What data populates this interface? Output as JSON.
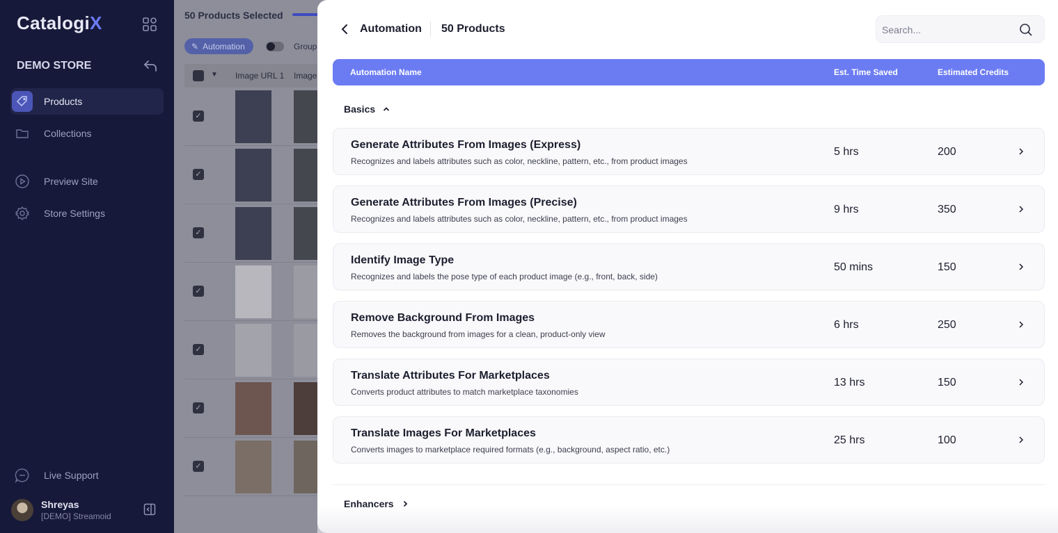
{
  "sidebar": {
    "logo_main": "Catalogi",
    "logo_accent": "X",
    "store_name": "DEMO STORE",
    "nav": [
      {
        "label": "Products",
        "icon": "tag-icon",
        "active": true
      },
      {
        "label": "Collections",
        "icon": "folder-icon",
        "active": false
      },
      {
        "label": "Preview Site",
        "icon": "play-circle-icon",
        "active": false
      },
      {
        "label": "Store Settings",
        "icon": "gear-icon",
        "active": false
      }
    ],
    "support_label": "Live Support",
    "user": {
      "name": "Shreyas",
      "org": "[DEMO] Streamoid"
    }
  },
  "background_table": {
    "selection_title": "50 Products Selected",
    "automation_pill": "Automation",
    "group_label": "Group",
    "columns": [
      "Image URL 1",
      "Image"
    ]
  },
  "panel": {
    "title": "Automation",
    "count": "50 Products",
    "search_placeholder": "Search...",
    "columns": {
      "name": "Automation Name",
      "time": "Est. Time Saved",
      "credits": "Estimated Credits"
    },
    "sections": [
      {
        "label": "Basics",
        "expanded": true,
        "items": [
          {
            "name": "Generate Attributes From Images (Express)",
            "desc": "Recognizes and labels attributes such as color, neckline, pattern, etc., from product images",
            "time": "5 hrs",
            "credits": "200"
          },
          {
            "name": "Generate Attributes From Images (Precise)",
            "desc": "Recognizes and labels attributes such as color, neckline, pattern, etc., from product images",
            "time": "9 hrs",
            "credits": "350"
          },
          {
            "name": "Identify Image Type",
            "desc": "Recognizes and labels the pose type of each product image (e.g., front, back, side)",
            "time": "50 mins",
            "credits": "150"
          },
          {
            "name": "Remove Background From Images",
            "desc": "Removes the background from images for a clean, product-only view",
            "time": "6 hrs",
            "credits": "250"
          },
          {
            "name": "Translate Attributes For Marketplaces",
            "desc": "Converts product attributes to match marketplace taxonomies",
            "time": "13 hrs",
            "credits": "150"
          },
          {
            "name": "Translate Images For Marketplaces",
            "desc": "Converts images to marketplace required formats (e.g., background, aspect ratio, etc.)",
            "time": "25 hrs",
            "credits": "100"
          }
        ]
      },
      {
        "label": "Enhancers",
        "expanded": false,
        "items": []
      }
    ]
  },
  "colors": {
    "accent": "#6b7cf3",
    "sidebar_bg": "#17193a",
    "active_icon": "#4b56b8"
  }
}
